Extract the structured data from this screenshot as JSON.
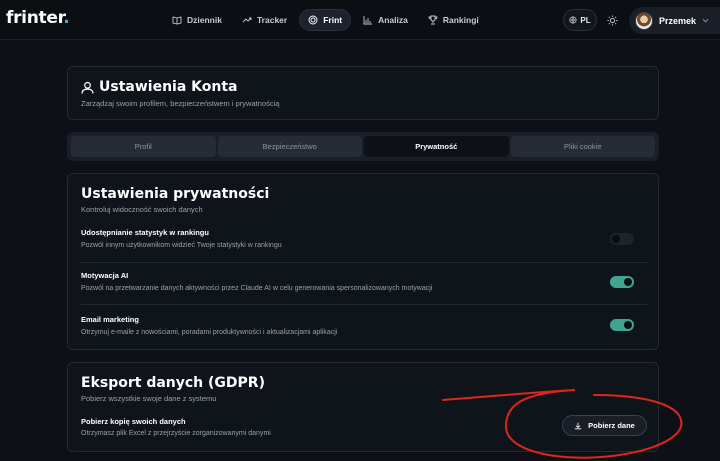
{
  "app": {
    "logo": "frinter",
    "logo_dot": "."
  },
  "nav": {
    "items": [
      {
        "label": "Dziennik",
        "icon": "book-icon",
        "active": false
      },
      {
        "label": "Tracker",
        "icon": "trend-icon",
        "active": false
      },
      {
        "label": "Frint",
        "icon": "target-icon",
        "active": true
      },
      {
        "label": "Analiza",
        "icon": "bar-chart-icon",
        "active": false
      },
      {
        "label": "Rankingi",
        "icon": "trophy-icon",
        "active": false
      }
    ],
    "language": "PL",
    "user_name": "Przemek"
  },
  "account": {
    "title": "Ustawienia Konta",
    "subtitle": "Zarządzaj swoim profilem, bezpieczeństwem i prywatnością"
  },
  "tabs": [
    {
      "label": "Profil",
      "active": false
    },
    {
      "label": "Bezpieczeństwo",
      "active": false
    },
    {
      "label": "Prywatność",
      "active": true
    },
    {
      "label": "Pliki cookie",
      "active": false
    }
  ],
  "privacy": {
    "title": "Ustawienia prywatności",
    "subtitle": "Kontroluj widoczność swoich danych",
    "settings": [
      {
        "label": "Udostępnianie statystyk w rankingu",
        "desc": "Pozwól innym użytkownikom widzieć Twoje statystyki w rankingu",
        "enabled": false
      },
      {
        "label": "Motywacja AI",
        "desc": "Pozwól na przetwarzanie danych aktywności przez Claude AI w celu generowania spersonalizowanych motywacji",
        "enabled": true
      },
      {
        "label": "Email marketing",
        "desc": "Otrzymuj e-maile z nowościami, poradami produktywności i aktualizacjami aplikacji",
        "enabled": true
      }
    ]
  },
  "export": {
    "title": "Eksport danych (GDPR)",
    "subtitle": "Pobierz wszystkie swoje dane z systemu",
    "item_label": "Pobierz kopię swoich danych",
    "item_desc": "Otrzymasz plik Excel z przejrzyście zorganizowanymi danymi",
    "button_label": "Pobierz dane"
  },
  "colors": {
    "accent_toggle": "#3ea591",
    "annotation": "#e0261b",
    "background": "#0d1117"
  }
}
